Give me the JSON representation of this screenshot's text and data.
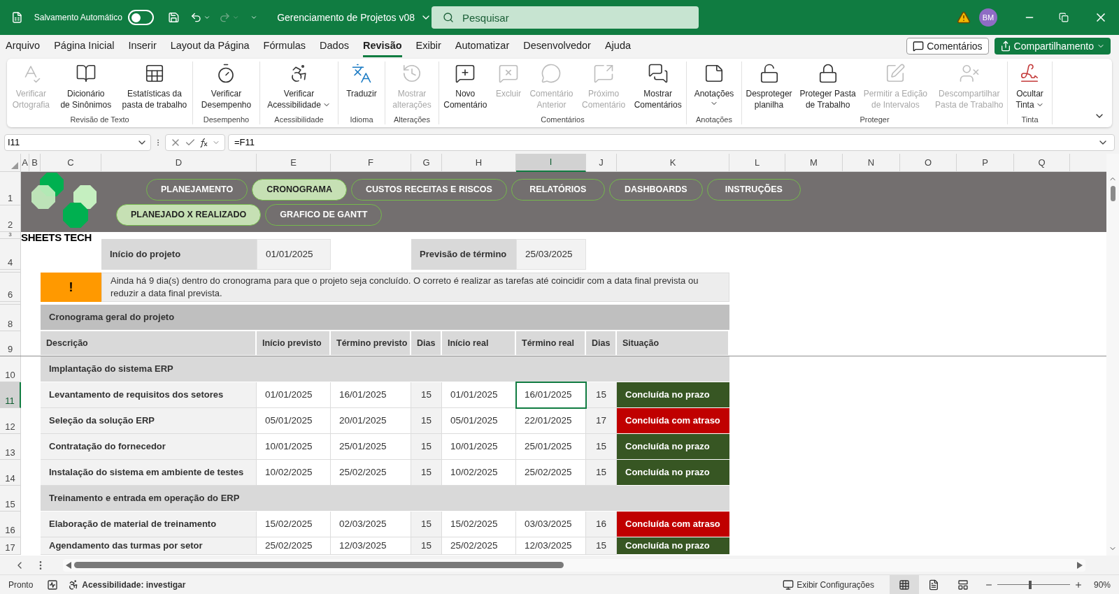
{
  "title_bar": {
    "autosave_label": "Salvamento Automático",
    "autosave_on": false,
    "document_title": "Gerenciamento de Projetos v08",
    "search_placeholder": "Pesquisar",
    "user_initials": "BM"
  },
  "menu_tabs": [
    {
      "label": "Arquivo",
      "selected": false
    },
    {
      "label": "Página Inicial",
      "selected": false
    },
    {
      "label": "Inserir",
      "selected": false
    },
    {
      "label": "Layout da Página",
      "selected": false
    },
    {
      "label": "Fórmulas",
      "selected": false
    },
    {
      "label": "Dados",
      "selected": false
    },
    {
      "label": "Revisão",
      "selected": true
    },
    {
      "label": "Exibir",
      "selected": false
    },
    {
      "label": "Automatizar",
      "selected": false
    },
    {
      "label": "Desenvolvedor",
      "selected": false
    },
    {
      "label": "Ajuda",
      "selected": false
    }
  ],
  "header_buttons": {
    "comments": "Comentários",
    "share": "Compartilhamento"
  },
  "ribbon": {
    "groups": [
      {
        "label": "Revisão de Texto",
        "commands": [
          {
            "kind": "spelling",
            "lines": [
              "Verificar",
              "Ortografia"
            ],
            "disabled": true,
            "dropdown": false
          },
          {
            "kind": "thesaurus",
            "lines": [
              "Dicionário",
              "de Sinônimos"
            ],
            "disabled": false,
            "dropdown": false
          },
          {
            "kind": "stats",
            "lines": [
              "Estatísticas da",
              "pasta de trabalho"
            ],
            "disabled": false,
            "dropdown": false
          }
        ]
      },
      {
        "label": "Desempenho",
        "commands": [
          {
            "kind": "performance",
            "lines": [
              "Verificar",
              "Desempenho"
            ],
            "disabled": false,
            "dropdown": false
          }
        ]
      },
      {
        "label": "Acessibilidade",
        "commands": [
          {
            "kind": "accessibility",
            "lines": [
              "Verificar",
              "Acessibilidade"
            ],
            "disabled": false,
            "dropdown": true
          }
        ]
      },
      {
        "label": "Idioma",
        "commands": [
          {
            "kind": "translate",
            "lines": [
              "Traduzir"
            ],
            "disabled": false,
            "dropdown": false
          }
        ]
      },
      {
        "label": "Alterações",
        "commands": [
          {
            "kind": "changes",
            "lines": [
              "Mostrar",
              "alterações"
            ],
            "disabled": true,
            "dropdown": false
          }
        ]
      },
      {
        "label": "Comentários",
        "commands": [
          {
            "kind": "new-comment",
            "lines": [
              "Novo",
              "Comentário"
            ],
            "disabled": false,
            "dropdown": false
          },
          {
            "kind": "delete",
            "lines": [
              "Excluir"
            ],
            "disabled": true,
            "dropdown": false
          },
          {
            "kind": "previous",
            "lines": [
              "Comentário",
              "Anterior"
            ],
            "disabled": true,
            "dropdown": false
          },
          {
            "kind": "next",
            "lines": [
              "Próximo",
              "Comentário"
            ],
            "disabled": true,
            "dropdown": false
          },
          {
            "kind": "show-comments",
            "lines": [
              "Mostrar",
              "Comentários"
            ],
            "disabled": false,
            "dropdown": false
          }
        ]
      },
      {
        "label": "Anotações",
        "commands": [
          {
            "kind": "notes",
            "lines": [
              "Anotações"
            ],
            "disabled": false,
            "dropdown": true
          }
        ]
      },
      {
        "label": "Proteger",
        "commands": [
          {
            "kind": "unprotect-sheet",
            "lines": [
              "Desproteger",
              "planilha"
            ],
            "disabled": false,
            "dropdown": false
          },
          {
            "kind": "protect-workbook",
            "lines": [
              "Proteger Pasta",
              "de Trabalho"
            ],
            "disabled": false,
            "dropdown": false
          },
          {
            "kind": "allow-edit",
            "lines": [
              "Permitir a Edição",
              "de Intervalos"
            ],
            "disabled": true,
            "dropdown": false
          },
          {
            "kind": "unshare",
            "lines": [
              "Descompartilhar",
              "Pasta de Trabalho"
            ],
            "disabled": true,
            "dropdown": false
          }
        ]
      },
      {
        "label": "Tinta",
        "commands": [
          {
            "kind": "hide-ink",
            "lines": [
              "Ocultar",
              "Tinta"
            ],
            "disabled": false,
            "dropdown": true
          }
        ]
      }
    ]
  },
  "formula_bar": {
    "name_box": "I11",
    "formula": "=F11"
  },
  "columns": [
    {
      "label": "A",
      "selected": false
    },
    {
      "label": "B",
      "selected": false
    },
    {
      "label": "C",
      "selected": false
    },
    {
      "label": "D",
      "selected": false
    },
    {
      "label": "E",
      "selected": false
    },
    {
      "label": "F",
      "selected": false
    },
    {
      "label": "G",
      "selected": false
    },
    {
      "label": "H",
      "selected": false
    },
    {
      "label": "I",
      "selected": true
    },
    {
      "label": "J",
      "selected": false
    },
    {
      "label": "K",
      "selected": false
    },
    {
      "label": "L",
      "selected": false
    },
    {
      "label": "M",
      "selected": false
    },
    {
      "label": "N",
      "selected": false
    },
    {
      "label": "O",
      "selected": false
    },
    {
      "label": "P",
      "selected": false
    },
    {
      "label": "Q",
      "selected": false
    }
  ],
  "rows": [
    {
      "label": "1",
      "selected": false
    },
    {
      "label": "2",
      "selected": false
    },
    {
      "label": "3",
      "selected": false
    },
    {
      "label": "4",
      "selected": false
    },
    {
      "label": "6",
      "selected": false
    },
    {
      "label": "8",
      "selected": false
    },
    {
      "label": "9",
      "selected": false
    },
    {
      "label": "10",
      "selected": false
    },
    {
      "label": "11",
      "selected": true
    },
    {
      "label": "12",
      "selected": false
    },
    {
      "label": "13",
      "selected": false
    },
    {
      "label": "14",
      "selected": false
    },
    {
      "label": "15",
      "selected": false
    },
    {
      "label": "16",
      "selected": false
    },
    {
      "label": "17",
      "selected": false
    }
  ],
  "sheet": {
    "logo_text": "SHEETS TECH",
    "nav_rows": [
      {
        "buttons": [
          {
            "label": "PLANEJAMENTO",
            "selected": false
          },
          {
            "label": "CRONOGRAMA",
            "selected": true
          },
          {
            "label": "CUSTOS RECEITAS E RISCOS",
            "selected": false
          },
          {
            "label": "RELATÓRIOS",
            "selected": false
          },
          {
            "label": "DASHBOARDS",
            "selected": false
          },
          {
            "label": "INSTRUÇÕES",
            "selected": false
          }
        ]
      },
      {
        "buttons": [
          {
            "label": "PLANEJADO X REALIZADO",
            "selected": true
          },
          {
            "label": "GRAFICO DE GANTT",
            "selected": false
          }
        ]
      }
    ],
    "project_start": {
      "label": "Início do projeto",
      "value": "01/01/2025"
    },
    "forecast_end": {
      "label": "Previsão de término",
      "value": "25/03/2025"
    },
    "alert": {
      "icon": "!",
      "message": "Ainda há 9 dia(s) dentro do cronograma para que o projeto seja concluído. O correto é realizar as tarefas até coincidir com a data final prevista ou reduzir a data final prevista."
    },
    "schedule": {
      "title": "Cronograma geral do projeto",
      "headers": [
        "Descrição",
        "Início previsto",
        "Término previsto",
        "Dias",
        "Início real",
        "Término real",
        "Dias",
        "Situação"
      ],
      "groups": [
        {
          "title": "Implantação do sistema ERP",
          "tasks": [
            {
              "description": "Levantamento de requisitos dos setores",
              "planned_start": "01/01/2025",
              "planned_end": "16/01/2025",
              "planned_days": "15",
              "actual_start": "01/01/2025",
              "actual_end": "16/01/2025",
              "actual_days": "15",
              "status": "Concluída no prazo",
              "color": "#375623"
            },
            {
              "description": "Seleção da solução ERP",
              "planned_start": "05/01/2025",
              "planned_end": "20/01/2025",
              "planned_days": "15",
              "actual_start": "05/01/2025",
              "actual_end": "22/01/2025",
              "actual_days": "17",
              "status": "Concluída com atraso",
              "color": "#c00000"
            },
            {
              "description": "Contratação do fornecedor",
              "planned_start": "10/01/2025",
              "planned_end": "25/01/2025",
              "planned_days": "15",
              "actual_start": "10/01/2025",
              "actual_end": "25/01/2025",
              "actual_days": "15",
              "status": "Concluída no prazo",
              "color": "#375623"
            },
            {
              "description": "Instalação do sistema em ambiente de testes",
              "planned_start": "10/02/2025",
              "planned_end": "25/02/2025",
              "planned_days": "15",
              "actual_start": "10/02/2025",
              "actual_end": "25/02/2025",
              "actual_days": "15",
              "status": "Concluída no prazo",
              "color": "#375623"
            }
          ]
        },
        {
          "title": "Treinamento e entrada em operação do ERP",
          "tasks": [
            {
              "description": "Elaboração de material de treinamento",
              "planned_start": "15/02/2025",
              "planned_end": "02/03/2025",
              "planned_days": "15",
              "actual_start": "15/02/2025",
              "actual_end": "03/03/2025",
              "actual_days": "16",
              "status": "Concluída com atraso",
              "color": "#c00000"
            },
            {
              "description": "Agendamento das turmas por setor",
              "planned_start": "25/02/2025",
              "planned_end": "12/03/2025",
              "planned_days": "15",
              "actual_start": "25/02/2025",
              "actual_end": "12/03/2025",
              "actual_days": "15",
              "status": "Concluída no prazo",
              "color": "#375623"
            }
          ]
        }
      ]
    }
  },
  "status_bar": {
    "ready": "Pronto",
    "accessibility": "Acessibilidade: investigar",
    "display_settings": "Exibir Configurações",
    "views": [
      {
        "kind": "normal",
        "selected": true
      },
      {
        "kind": "page-layout",
        "selected": false
      },
      {
        "kind": "page-break",
        "selected": false
      }
    ],
    "zoom": {
      "level": 0.45,
      "label": "90%"
    }
  }
}
